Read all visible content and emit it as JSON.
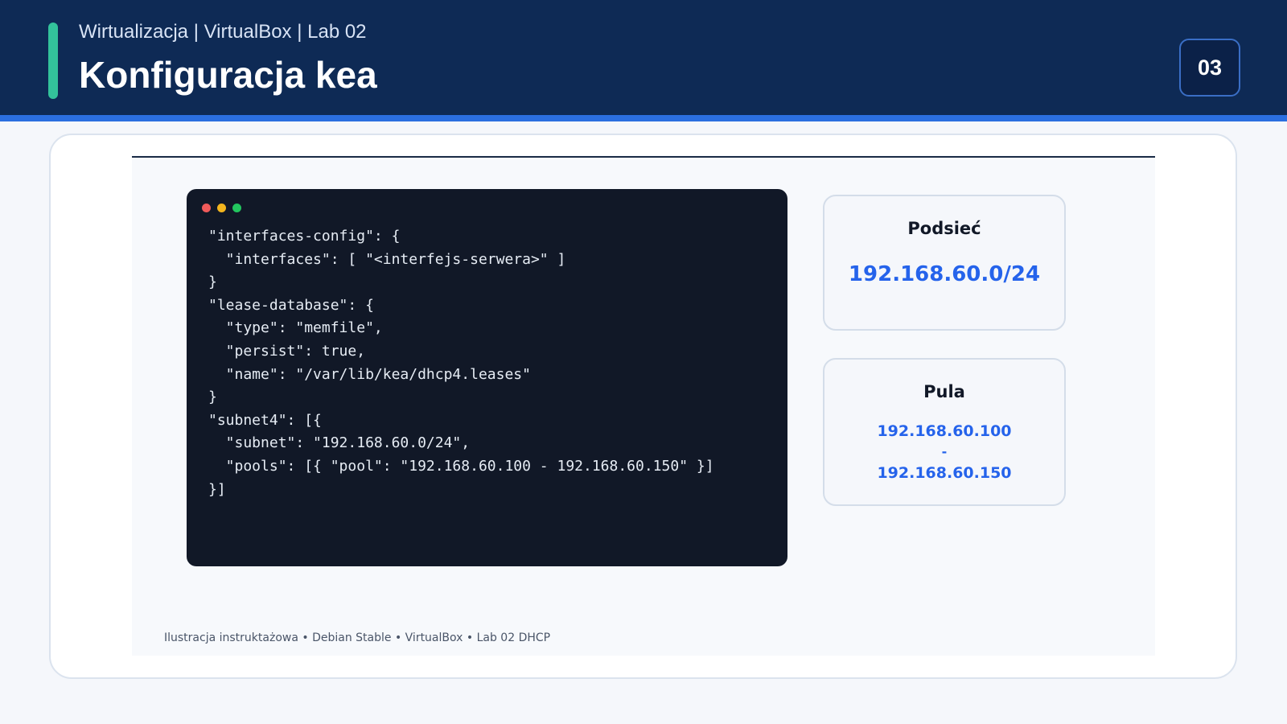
{
  "header": {
    "subtitle": "Wirtualizacja | VirtualBox | Lab 02",
    "title": "Konfiguracja kea",
    "page_number": "03"
  },
  "terminal": {
    "code_lines": [
      "\"interfaces-config\": {",
      "  \"interfaces\": [ \"<interfejs-serwera>\" ]",
      "}",
      "\"lease-database\": {",
      "  \"type\": \"memfile\",",
      "  \"persist\": true,",
      "  \"name\": \"/var/lib/kea/dhcp4.leases\"",
      "}",
      "\"subnet4\": [{",
      "  \"subnet\": \"192.168.60.0/24\",",
      "  \"pools\": [{ \"pool\": \"192.168.60.100 - 192.168.60.150\" }]",
      "}]"
    ]
  },
  "subnet_card": {
    "title": "Podsieć",
    "value": "192.168.60.0/24"
  },
  "pool_card": {
    "title": "Pula",
    "start": "192.168.60.100",
    "separator": "-",
    "end": "192.168.60.150"
  },
  "footer": {
    "text": "Ilustracja instruktażowa • Debian Stable • VirtualBox • Lab 02 DHCP"
  },
  "colors": {
    "header_bg": "#0e2a55",
    "header_stripe": "#2b6fe0",
    "accent": "#33c29b",
    "terminal_bg": "#111827",
    "value_blue": "#2563eb"
  }
}
